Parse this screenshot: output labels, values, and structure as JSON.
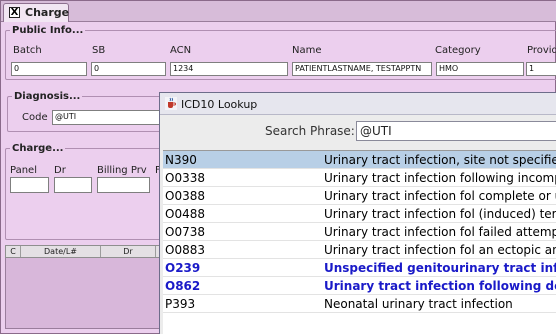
{
  "charge_window": {
    "tab_title": "Charge",
    "close_glyph": "X",
    "public_info": {
      "legend": "Public Info...",
      "labels": {
        "batch": "Batch",
        "sb": "SB",
        "acn": "ACN",
        "name": "Name",
        "category": "Category",
        "provider": "Provid"
      },
      "values": {
        "batch": "0",
        "sb": "0",
        "acn": "1234",
        "name": "PATIENTLASTNAME, TESTAPPTN",
        "category": "HMO",
        "provider": "1"
      }
    },
    "diagnosis": {
      "legend": "Diagnosis...",
      "code_label": "Code",
      "code_value": "@UTI"
    },
    "charge": {
      "legend": "Charge...",
      "labels": {
        "panel": "Panel",
        "dr": "Dr",
        "billing_prv": "Billing Prv",
        "extra": "F"
      }
    },
    "grid": {
      "columns": [
        "C",
        "Date/L#",
        "Dr",
        ""
      ]
    }
  },
  "dialog": {
    "title": "ICD10 Lookup",
    "search_label": "Search Phrase:",
    "search_value": "@UTI",
    "results": [
      {
        "code": "N390",
        "description": "Urinary tract infection, site not specified",
        "selected": true,
        "highlight": false
      },
      {
        "code": "O0338",
        "description": "Urinary tract infection following incomplete spontaneous abortion",
        "selected": false,
        "highlight": false
      },
      {
        "code": "O0388",
        "description": "Urinary tract infection fol complete or unsp spontaneous abortion",
        "selected": false,
        "highlight": false
      },
      {
        "code": "O0488",
        "description": "Urinary tract infection fol (induced) termination of pregnancy",
        "selected": false,
        "highlight": false
      },
      {
        "code": "O0738",
        "description": "Urinary tract infection fol failed attempted termination of pregnancy",
        "selected": false,
        "highlight": false
      },
      {
        "code": "O0883",
        "description": "Urinary tract infection fol an ectopic and molar pregnancy",
        "selected": false,
        "highlight": false
      },
      {
        "code": "O239",
        "description": "Unspecified genitourinary tract infection in pregnancy",
        "selected": false,
        "highlight": true
      },
      {
        "code": "O862",
        "description": "Urinary tract infection following delivery",
        "selected": false,
        "highlight": true
      },
      {
        "code": "P393",
        "description": "Neonatal urinary tract infection",
        "selected": false,
        "highlight": false
      }
    ]
  },
  "colors": {
    "window_bg": "#eccfee",
    "selected_row": "#b8cfe6",
    "highlight_text": "#1a1ac8"
  },
  "icons": [
    "close-icon",
    "java-cup-icon"
  ]
}
